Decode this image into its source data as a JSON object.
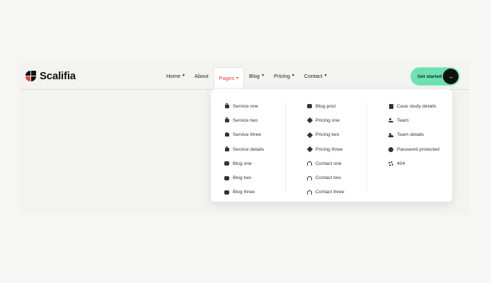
{
  "brand": {
    "name": "Scalifia"
  },
  "nav": {
    "items": [
      {
        "label": "Home",
        "chevron": "⌄"
      },
      {
        "label": "About"
      },
      {
        "label": "Pages",
        "chevron": "⌄"
      },
      {
        "label": "Blog",
        "chevron": "⌄"
      },
      {
        "label": "Pricing",
        "chevron": "⌄"
      },
      {
        "label": "Contact",
        "chevron": "⌄"
      }
    ],
    "active": "Pages"
  },
  "cta": {
    "label": "Get started",
    "arrow": "→"
  },
  "dropdown": {
    "columns": [
      {
        "items": [
          {
            "label": "Service one",
            "icon": "briefcase-icon"
          },
          {
            "label": "Service two",
            "icon": "briefcase-icon"
          },
          {
            "label": "Service three",
            "icon": "briefcase-icon"
          },
          {
            "label": "Service details",
            "icon": "briefcase-icon"
          },
          {
            "label": "Blog one",
            "icon": "chat-icon"
          },
          {
            "label": "Blog two",
            "icon": "chat-icon"
          },
          {
            "label": "Blog three",
            "icon": "chat-icon"
          }
        ]
      },
      {
        "items": [
          {
            "label": "Blog post",
            "icon": "chat-icon"
          },
          {
            "label": "Pricing one",
            "icon": "tag-icon"
          },
          {
            "label": "Pricing two",
            "icon": "tag-icon"
          },
          {
            "label": "Pricing three",
            "icon": "tag-icon"
          },
          {
            "label": "Contact one",
            "icon": "headset-icon"
          },
          {
            "label": "Contact two",
            "icon": "headset-icon"
          },
          {
            "label": "Contact three",
            "icon": "headset-icon"
          }
        ]
      },
      {
        "items": [
          {
            "label": "Case study details",
            "icon": "document-icon"
          },
          {
            "label": "Team",
            "icon": "team-icon"
          },
          {
            "label": "Team details",
            "icon": "team-icon"
          },
          {
            "label": "Password protected",
            "icon": "lock-icon"
          },
          {
            "label": "404",
            "icon": "gear-icon"
          }
        ]
      }
    ]
  },
  "colors": {
    "accent": "#e2463a",
    "cta": "#6ee0b1",
    "background": "#f6f6f4"
  }
}
